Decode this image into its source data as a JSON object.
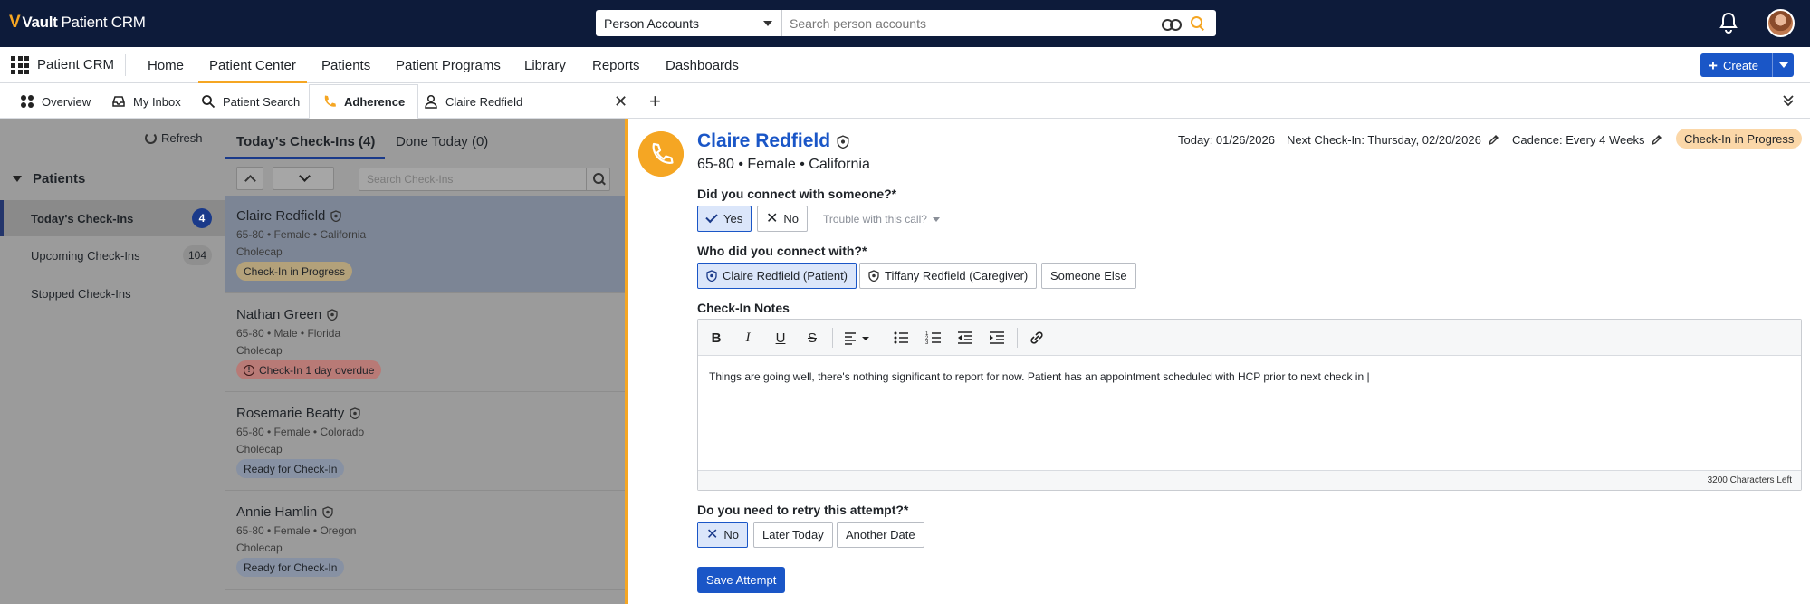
{
  "topbar": {
    "logo_brand": "Vault",
    "logo_product": "Patient CRM",
    "search_scope": "Person Accounts",
    "search_placeholder": "Search person accounts"
  },
  "nav": {
    "app_name": "Patient CRM",
    "items": [
      "Home",
      "Patient Center",
      "Patients",
      "Patient Programs",
      "Library",
      "Reports",
      "Dashboards"
    ],
    "active": "Patient Center",
    "create_label": "Create"
  },
  "tabs": {
    "items": [
      "Overview",
      "My Inbox",
      "Patient Search",
      "Adherence",
      "Claire Redfield"
    ],
    "active": "Adherence"
  },
  "sidebar": {
    "refresh_label": "Refresh",
    "section_title": "Patients",
    "items": [
      {
        "label": "Today's Check-Ins",
        "count": "4"
      },
      {
        "label": "Upcoming Check-Ins",
        "count": "104"
      },
      {
        "label": "Stopped Check-Ins",
        "count": ""
      }
    ]
  },
  "list": {
    "tab_today": "Today's Check-Ins (4)",
    "tab_done": "Done Today (0)",
    "search_placeholder": "Search Check-Ins",
    "cards": [
      {
        "name": "Claire Redfield",
        "demo": "65-80 • Female • California",
        "drug": "Cholecap",
        "status": "Check-In in Progress",
        "status_type": "progress"
      },
      {
        "name": "Nathan Green",
        "demo": "65-80 • Male • Florida",
        "drug": "Cholecap",
        "status": "Check-In 1 day overdue",
        "status_type": "overdue"
      },
      {
        "name": "Rosemarie Beatty",
        "demo": "65-80 • Female • Colorado",
        "drug": "Cholecap",
        "status": "Ready for Check-In",
        "status_type": "ready"
      },
      {
        "name": "Annie Hamlin",
        "demo": "65-80 • Female • Oregon",
        "drug": "Cholecap",
        "status": "Ready for Check-In",
        "status_type": "ready"
      }
    ]
  },
  "detail": {
    "name": "Claire Redfield",
    "demo": "65-80 • Female • California",
    "today": "Today: 01/26/2026",
    "next_checkin": "Next Check-In: Thursday, 02/20/2026",
    "cadence": "Cadence: Every 4 Weeks",
    "status": "Check-In in Progress",
    "q1": "Did you connect with someone?*",
    "q1_yes": "Yes",
    "q1_no": "No",
    "q1_trouble": "Trouble with this call?",
    "q2": "Who did you connect with?*",
    "q2_opts": [
      "Claire Redfield (Patient)",
      "Tiffany Redfield (Caregiver)",
      "Someone Else"
    ],
    "notes_label": "Check-In Notes",
    "notes_text": "Things are going well, there's nothing significant to report for now. Patient has an appointment scheduled with HCP prior to next check in |",
    "chars_left": "3200 Characters Left",
    "q3": "Do you need to retry this attempt?*",
    "q3_opts": [
      "No",
      "Later Today",
      "Another Date"
    ],
    "save_label": "Save Attempt"
  },
  "colors": {
    "brand_navy": "#0d1b3a",
    "accent_orange": "#f5a623",
    "primary_blue": "#1a56c7"
  }
}
